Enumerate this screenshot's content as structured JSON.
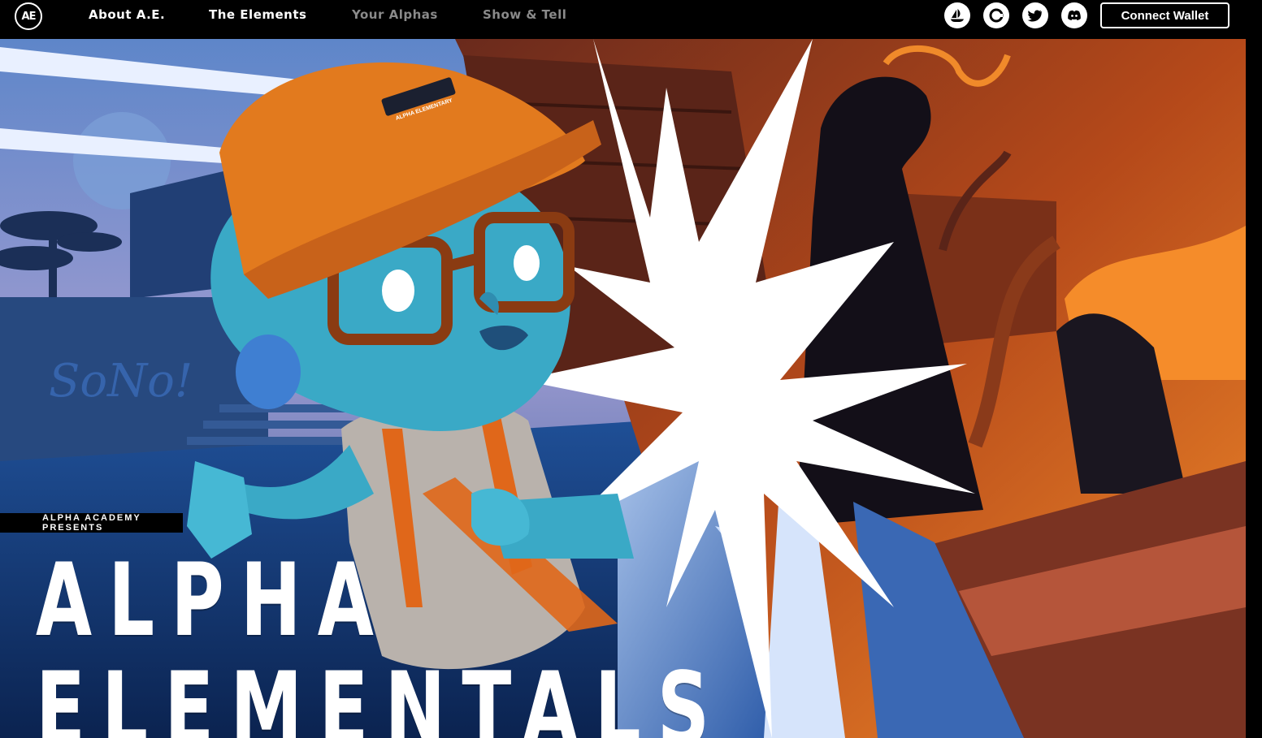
{
  "nav": {
    "logo_text": "AE",
    "links": [
      {
        "label": "About A.E.",
        "state": "active"
      },
      {
        "label": "The Elements",
        "state": "active"
      },
      {
        "label": "Your Alphas",
        "state": "disabled"
      },
      {
        "label": "Show & Tell",
        "state": "disabled"
      }
    ],
    "socials": [
      "opensea-icon",
      "coinbase-icon",
      "twitter-icon",
      "discord-icon"
    ],
    "connect_label": "Connect Wallet"
  },
  "hero": {
    "presents": "ALPHA ACADEMY PRESENTS",
    "title_line1": "ALPHA",
    "title_line2": "ELEMENTALS",
    "cap_label": "ALPHA ELEMENTARY"
  },
  "colors": {
    "nav_bg": "#000000",
    "cool_blue": "#2a5ea8",
    "warm_orange": "#e06a1c",
    "skin_teal": "#3aa9c6",
    "burst_white": "#ffffff"
  }
}
